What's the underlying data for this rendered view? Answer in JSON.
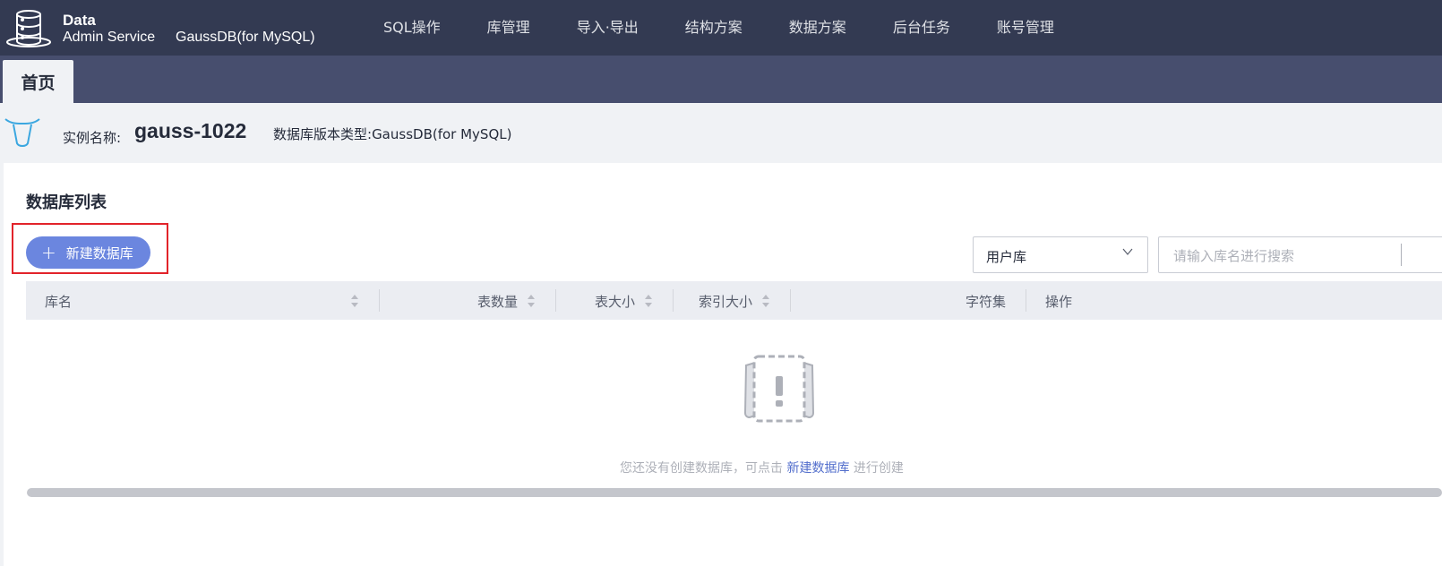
{
  "header": {
    "logo_line1": "Data",
    "logo_line2": "Admin Service",
    "product": "GaussDB(for MySQL)",
    "nav": [
      {
        "label": "SQL操作"
      },
      {
        "label": "库管理"
      },
      {
        "label": "导入·导出"
      },
      {
        "label": "结构方案"
      },
      {
        "label": "数据方案"
      },
      {
        "label": "后台任务"
      },
      {
        "label": "账号管理"
      }
    ]
  },
  "tabs": {
    "home": "首页"
  },
  "instance": {
    "name_label": "实例名称:",
    "name": "gauss-1022",
    "version_label": "数据库版本类型:",
    "version": "GaussDB(for MySQL)"
  },
  "main": {
    "section_title": "数据库列表",
    "new_db_button": "新建数据库",
    "filter": {
      "selected": "用户库"
    },
    "search": {
      "placeholder": "请输入库名进行搜索"
    },
    "table": {
      "columns": [
        "库名",
        "表数量",
        "表大小",
        "索引大小",
        "字符集",
        "操作"
      ]
    },
    "empty": {
      "text_before": "您还没有创建数据库，可点击 ",
      "link": "新建数据库",
      "text_after": " 进行创建"
    }
  },
  "colors": {
    "topbar": "#333a52",
    "tabbar": "#474e6e",
    "primary_button": "#6b86df",
    "highlight": "#e2232a",
    "link": "#526ecc"
  }
}
